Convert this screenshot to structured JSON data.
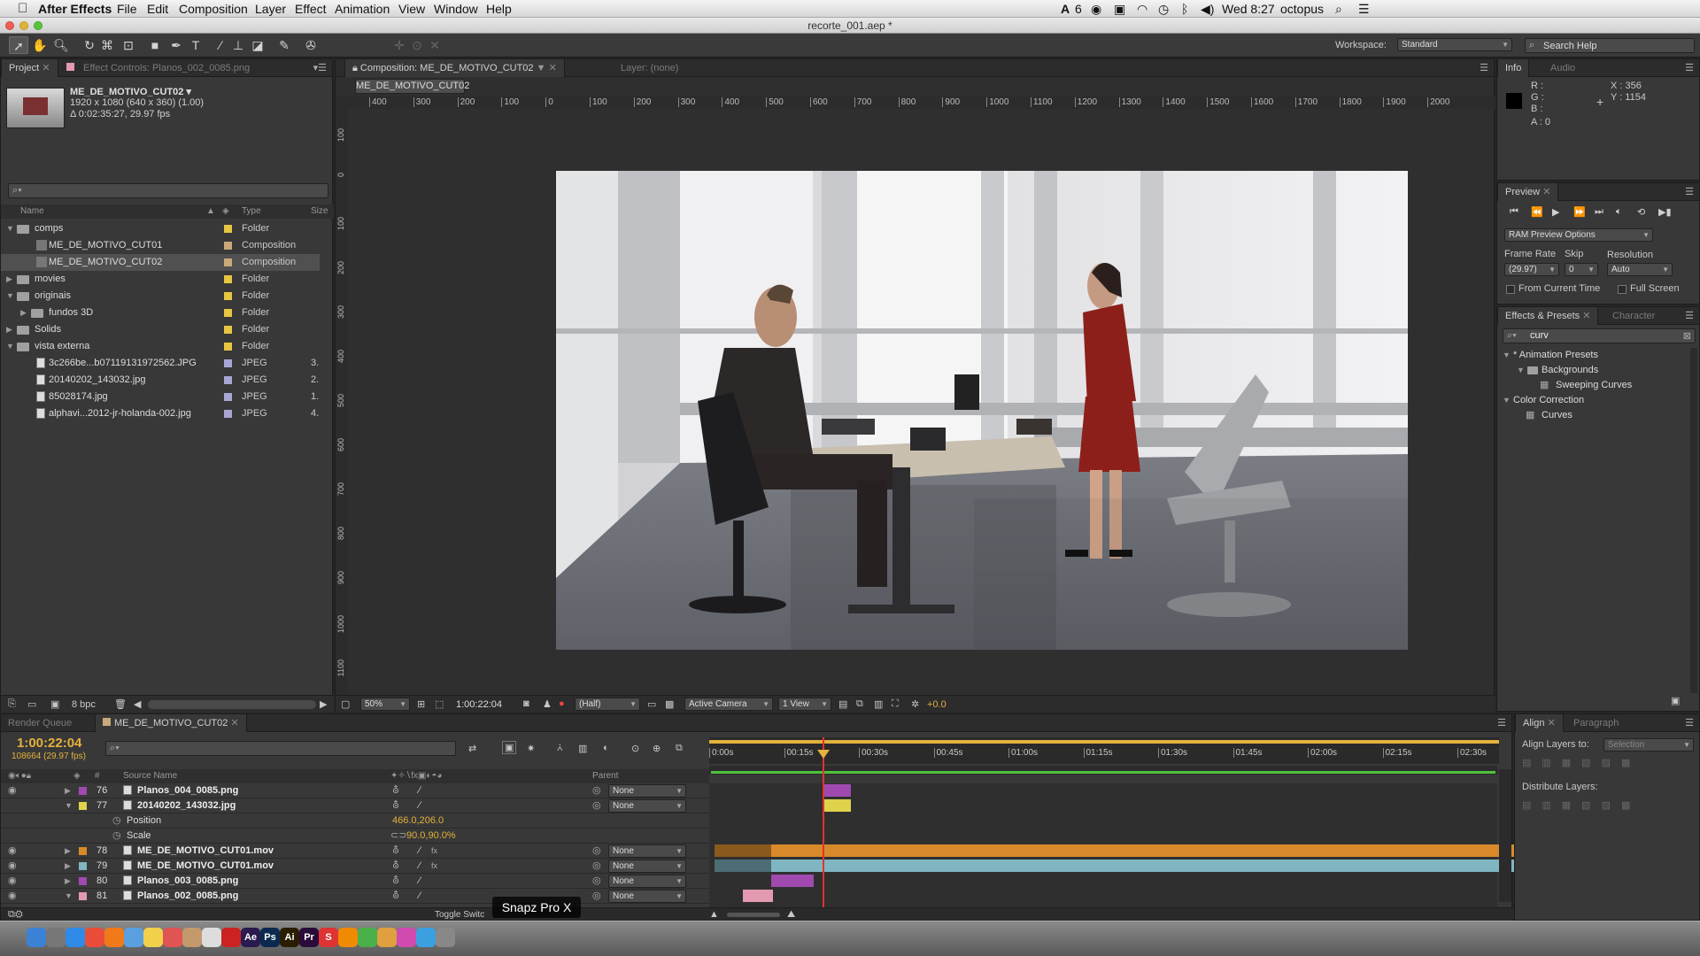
{
  "menubar": {
    "app": "After Effects",
    "items": [
      "File",
      "Edit",
      "Composition",
      "Layer",
      "Effect",
      "Animation",
      "View",
      "Window",
      "Help"
    ],
    "status": {
      "ai_count": "6",
      "clock": "Wed 8:27",
      "user": "octopus"
    }
  },
  "window": {
    "title": "recorte_001.aep *"
  },
  "toolbar": {
    "workspace_label": "Workspace:",
    "workspace_value": "Standard",
    "search_help_placeholder": "Search Help"
  },
  "project": {
    "tabs": {
      "project": "Project",
      "effect_controls": "Effect Controls: Planos_002_0085.png"
    },
    "selected_name": "ME_DE_MOTIVO_CUT02 ▾",
    "selected_dims": "1920 x 1080  (640 x 360) (1.00)",
    "selected_duration": "Δ 0:02:35:27, 29.97 fps",
    "columns": {
      "name": "Name",
      "type": "Type",
      "size": "Size"
    },
    "items": [
      {
        "name": "comps",
        "type": "Folder",
        "size": "",
        "level": 0,
        "kind": "folder",
        "open": true,
        "color": "#e8c641"
      },
      {
        "name": "ME_DE_MOTIVO_CUT01",
        "type": "Composition",
        "size": "",
        "level": 1,
        "kind": "comp",
        "color": "#c9a97a"
      },
      {
        "name": "ME_DE_MOTIVO_CUT02",
        "type": "Composition",
        "size": "",
        "level": 1,
        "kind": "comp",
        "color": "#c9a97a",
        "selected": true
      },
      {
        "name": "movies",
        "type": "Folder",
        "size": "",
        "level": 0,
        "kind": "folder",
        "open": false,
        "color": "#e8c641"
      },
      {
        "name": "originais",
        "type": "Folder",
        "size": "",
        "level": 0,
        "kind": "folder",
        "open": true,
        "color": "#e8c641"
      },
      {
        "name": "fundos 3D",
        "type": "Folder",
        "size": "",
        "level": 1,
        "kind": "folder",
        "open": false,
        "color": "#e8c641"
      },
      {
        "name": "Solids",
        "type": "Folder",
        "size": "",
        "level": 0,
        "kind": "folder",
        "open": false,
        "color": "#e8c641"
      },
      {
        "name": "vista externa",
        "type": "Folder",
        "size": "",
        "level": 0,
        "kind": "folder",
        "open": true,
        "color": "#e8c641"
      },
      {
        "name": "3c266be...b07119131972562.JPG",
        "type": "JPEG",
        "size": "3.",
        "level": 1,
        "kind": "file",
        "color": "#a9a6d6"
      },
      {
        "name": "20140202_143032.jpg",
        "type": "JPEG",
        "size": "2.",
        "level": 1,
        "kind": "file",
        "color": "#a9a6d6"
      },
      {
        "name": "85028174.jpg",
        "type": "JPEG",
        "size": "1.",
        "level": 1,
        "kind": "file",
        "color": "#a9a6d6"
      },
      {
        "name": "alphavi...2012-jr-holanda-002.jpg",
        "type": "JPEG",
        "size": "4.",
        "level": 1,
        "kind": "file",
        "color": "#a9a6d6"
      }
    ],
    "bpc": "8 bpc"
  },
  "composition": {
    "tab": "Composition: ME_DE_MOTIVO_CUT02",
    "layer_tab": "Layer: (none)",
    "comp_button": "ME_DE_MOTIVO_CUT02",
    "ruler_ticks": [
      "400",
      "300",
      "200",
      "100",
      "0",
      "100",
      "200",
      "300",
      "400",
      "500",
      "600",
      "700",
      "800",
      "900",
      "1000",
      "1100",
      "1200",
      "1300",
      "1400",
      "1500",
      "1600",
      "1700",
      "1800",
      "1900",
      "2000"
    ],
    "vruler_ticks": [
      "100",
      "0",
      "100",
      "200",
      "300",
      "400",
      "500",
      "600",
      "700",
      "800",
      "900",
      "1000",
      "1100"
    ],
    "zoom": "50%",
    "timecode": "1:00:22:04",
    "resolution": "(Half)",
    "camera": "Active Camera",
    "views": "1 View",
    "exposure": "+0.0"
  },
  "info": {
    "tabs": {
      "info": "Info",
      "audio": "Audio"
    },
    "r": "R :",
    "g": "G :",
    "b": "B :",
    "a": "A : 0",
    "x": "X : 356",
    "y": "Y : 1154"
  },
  "preview": {
    "tab": "Preview",
    "ram_options": "RAM Preview Options",
    "frame_rate_label": "Frame Rate",
    "skip_label": "Skip",
    "resolution_label": "Resolution",
    "frame_rate": "(29.97)",
    "skip": "0",
    "resolution": "Auto",
    "from_current": "From Current Time",
    "full_screen": "Full Screen"
  },
  "effects": {
    "tabs": {
      "effects": "Effects & Presets",
      "character": "Character"
    },
    "search": "curv",
    "tree": [
      {
        "label": "* Animation Presets",
        "level": 0,
        "kind": "group"
      },
      {
        "label": "Backgrounds",
        "level": 1,
        "kind": "folder"
      },
      {
        "label": "Sweeping Curves",
        "level": 2,
        "kind": "preset"
      },
      {
        "label": "Color Correction",
        "level": 0,
        "kind": "group"
      },
      {
        "label": "Curves",
        "level": 1,
        "kind": "effect"
      }
    ]
  },
  "timeline": {
    "tabs": {
      "render_queue": "Render Queue",
      "comp": "ME_DE_MOTIVO_CUT02"
    },
    "timecode": "1:00:22:04",
    "frames": "108664 (29.97 fps)",
    "columns": {
      "source": "Source Name",
      "parent": "Parent",
      "num": "#"
    },
    "ruler": [
      "0:00s",
      "00:15s",
      "00:30s",
      "00:45s",
      "01:00s",
      "01:15s",
      "01:30s",
      "01:45s",
      "02:00s",
      "02:15s",
      "02:30s"
    ],
    "layers": [
      {
        "num": "76",
        "name": "Planos_004_0085.png",
        "color": "#a04ab0",
        "parent": "None",
        "open": false,
        "kind": "img"
      },
      {
        "num": "77",
        "name": "20140202_143032.jpg",
        "color": "#e0d24a",
        "parent": "None",
        "open": true,
        "kind": "img"
      },
      {
        "prop": "Position",
        "value": "466.0,206.0"
      },
      {
        "prop": "Scale",
        "value": "90.0,90.0%"
      },
      {
        "num": "78",
        "name": "ME_DE_MOTIVO_CUT01.mov",
        "color": "#d88a2a",
        "parent": "None",
        "open": false,
        "kind": "mov"
      },
      {
        "num": "79",
        "name": "ME_DE_MOTIVO_CUT01.mov",
        "color": "#7fb6c2",
        "parent": "None",
        "open": false,
        "kind": "mov"
      },
      {
        "num": "80",
        "name": "Planos_003_0085.png",
        "color": "#a04ab0",
        "parent": "None",
        "open": false,
        "kind": "img"
      },
      {
        "num": "81",
        "name": "Planos_002_0085.png",
        "color": "#e39ab0",
        "parent": "None",
        "open": true,
        "kind": "img"
      }
    ],
    "toggle_label": "Toggle Switc",
    "snapz_label": "Snapz Pro X"
  },
  "align": {
    "tabs": {
      "align": "Align",
      "paragraph": "Paragraph"
    },
    "align_to_label": "Align Layers to:",
    "align_to_value": "Selection",
    "distribute_label": "Distribute Layers:"
  },
  "dock": {
    "icons": [
      "Finder",
      "Prefs",
      "Safari",
      "Chrome",
      "Firefox",
      "Mail",
      "Notes",
      "Calendar",
      "Contacts",
      "TextEdit",
      "Acrobat",
      "Ae",
      "Ps",
      "Ai",
      "Pr",
      "S",
      "VLC",
      "Maps",
      "Photos",
      "iTunes",
      "App",
      "Misc"
    ]
  }
}
